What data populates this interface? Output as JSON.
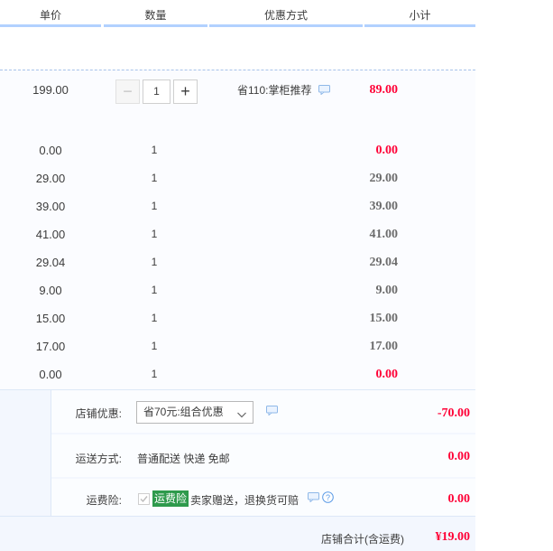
{
  "header": {
    "col_price": "单价",
    "col_qty": "数量",
    "col_discount": "优惠方式",
    "col_subtotal": "小计"
  },
  "main_item": {
    "price": "199.00",
    "qty": "1",
    "minus": "−",
    "plus": "+",
    "promo": "省110:掌柜推荐",
    "subtotal": "89.00"
  },
  "items": [
    {
      "price": "0.00",
      "qty": "1",
      "subtotal": "0.00",
      "subtotal_color": "red"
    },
    {
      "price": "29.00",
      "qty": "1",
      "subtotal": "29.00",
      "subtotal_color": "grey"
    },
    {
      "price": "39.00",
      "qty": "1",
      "subtotal": "39.00",
      "subtotal_color": "grey"
    },
    {
      "price": "41.00",
      "qty": "1",
      "subtotal": "41.00",
      "subtotal_color": "grey"
    },
    {
      "price": "29.04",
      "qty": "1",
      "subtotal": "29.04",
      "subtotal_color": "grey"
    },
    {
      "price": "9.00",
      "qty": "1",
      "subtotal": "9.00",
      "subtotal_color": "grey"
    },
    {
      "price": "15.00",
      "qty": "1",
      "subtotal": "15.00",
      "subtotal_color": "grey"
    },
    {
      "price": "17.00",
      "qty": "1",
      "subtotal": "17.00",
      "subtotal_color": "grey"
    },
    {
      "price": "0.00",
      "qty": "1",
      "subtotal": "0.00",
      "subtotal_color": "red"
    }
  ],
  "shop_discount": {
    "label": "店铺优惠:",
    "selected": "省70元:组合优惠",
    "amount": "-70.00"
  },
  "shipping": {
    "label": "运送方式:",
    "method": "普通配送 快递 免邮",
    "amount": "0.00"
  },
  "insurance": {
    "label": "运费险:",
    "badge": "运费险",
    "text": "卖家赠送，退换货可赔",
    "amount": "0.00",
    "checked": true
  },
  "total": {
    "label": "店铺合计(含运费)",
    "value": "¥19.00"
  },
  "colors": {
    "accent_red": "#ff0036",
    "header_line": "#b2d1ff",
    "badge_green": "#2e9a4c"
  },
  "icons": {
    "chat": "chat-bubble-icon",
    "help": "question-circle-icon",
    "dropdown": "chevron-down-icon",
    "check": "check-icon"
  }
}
